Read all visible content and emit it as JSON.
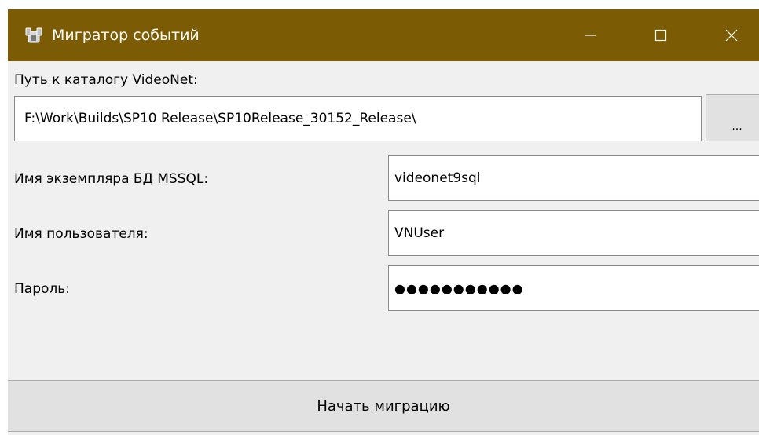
{
  "window": {
    "title": "Мигратор событий",
    "titlebar_color": "#7b5c05",
    "controls": {
      "minimize_icon": "minimize-icon",
      "maximize_icon": "maximize-icon",
      "close_icon": "close-icon"
    }
  },
  "form": {
    "path_label": "Путь к каталогу VideoNet:",
    "path_value": "F:\\Work\\Builds\\SP10 Release\\SP10Release_30152_Release\\",
    "browse_label": "...",
    "instance_label": "Имя экземпляра БД MSSQL:",
    "instance_value": "videonet9sql",
    "user_label": "Имя пользователя:",
    "user_value": "VNUser",
    "password_label": "Пароль:",
    "password_masked": "●●●●●●●●●●●"
  },
  "actions": {
    "start_label": "Начать миграцию"
  }
}
